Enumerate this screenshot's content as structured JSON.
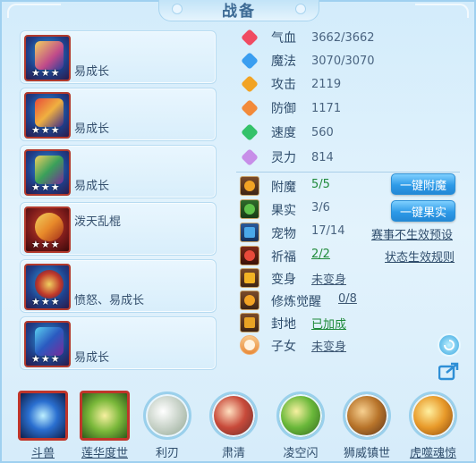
{
  "title": "战备",
  "equipment": [
    {
      "desc": "易成长",
      "stars": "★★★",
      "color": "#c0352a"
    },
    {
      "desc": "易成长",
      "stars": "★★★",
      "color": "#c0352a"
    },
    {
      "desc": "易成长",
      "stars": "★★★",
      "color": "#c0352a"
    },
    {
      "desc": "泼天乱棍",
      "stars": "★★★",
      "color": "#c0352a"
    },
    {
      "desc": "愤怒、易成长",
      "stars": "★★★",
      "color": "#c0352a"
    },
    {
      "desc": "易成长",
      "stars": "★★★",
      "color": "#c0352a"
    }
  ],
  "stats": [
    {
      "name": "气血",
      "value": "3662/3662",
      "icon": "heart-icon",
      "color": "#f04b62"
    },
    {
      "name": "魔法",
      "value": "3070/3070",
      "icon": "mana-icon",
      "color": "#3a9ef0"
    },
    {
      "name": "攻击",
      "value": "2119",
      "icon": "sword-icon",
      "color": "#f2a324"
    },
    {
      "name": "防御",
      "value": "1171",
      "icon": "shield-icon",
      "color": "#f28a3a"
    },
    {
      "name": "速度",
      "value": "560",
      "icon": "speed-icon",
      "color": "#34c26a"
    },
    {
      "name": "灵力",
      "value": "814",
      "icon": "spirit-icon",
      "color": "#c78ee8"
    }
  ],
  "extras": [
    {
      "name": "附魔",
      "value": "5/5",
      "style": "green-plain",
      "icon": "enchant-icon",
      "color": "#f2a324"
    },
    {
      "name": "果实",
      "value": "3/6",
      "style": "plain",
      "icon": "fruit-icon",
      "color": "#5ec24a"
    },
    {
      "name": "宠物",
      "value": "17/14",
      "style": "plain",
      "icon": "pet-icon",
      "color": "#4aa8e8"
    },
    {
      "name": "祈福",
      "value": "2/2",
      "style": "green",
      "icon": "blessing-icon",
      "color": "#e84a3a"
    },
    {
      "name": "变身",
      "value": "未变身",
      "style": "ul",
      "icon": "transform-icon",
      "color": "#f2b324"
    },
    {
      "name": "修炼觉醒",
      "value": "0/8",
      "style": "ul",
      "icon": "cultivation-icon",
      "color": "#f2a324"
    },
    {
      "name": "封地",
      "value": "已加成",
      "style": "green",
      "icon": "fief-icon",
      "color": "#e8a324"
    },
    {
      "name": "子女",
      "value": "未变身",
      "style": "ul",
      "icon": "child-icon",
      "color": "#f28a3a"
    }
  ],
  "buttons": {
    "enchant": "一键附魔",
    "fruit": "一键果实"
  },
  "links": {
    "preset": "赛事不生效预设",
    "rules": "状态生效规则"
  },
  "skills": [
    {
      "label": "斗兽",
      "shape": "square",
      "underline": true,
      "color": "#2a6fd0"
    },
    {
      "label": "莲华度世",
      "shape": "square",
      "underline": true,
      "color": "#7ab83a"
    },
    {
      "label": "利刃",
      "shape": "circle",
      "underline": false,
      "color": "#d8e0d8"
    },
    {
      "label": "肃清",
      "shape": "circle",
      "underline": false,
      "color": "#c84a3a"
    },
    {
      "label": "凌空闪",
      "shape": "circle",
      "underline": false,
      "color": "#6ab83a"
    },
    {
      "label": "狮威镇世",
      "shape": "circle",
      "underline": false,
      "color": "#b8742a"
    },
    {
      "label": "虎噬魂惊",
      "shape": "circle",
      "underline": true,
      "color": "#e89a2a"
    }
  ]
}
